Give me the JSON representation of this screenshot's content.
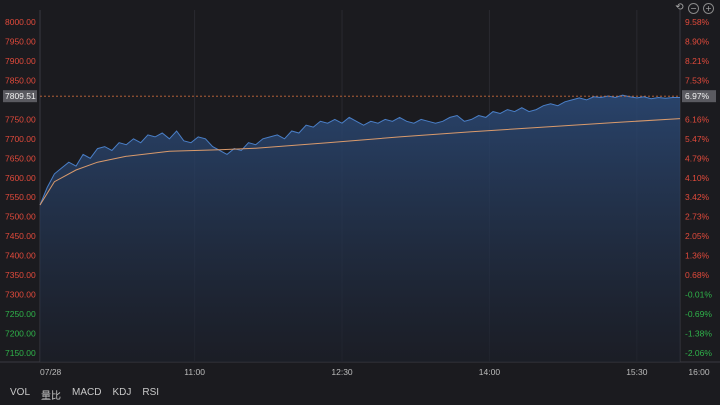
{
  "toolbar": {
    "undo_icon": "undo-icon",
    "zoom_out_icon": "minus-circle-icon",
    "zoom_in_icon": "plus-circle-icon"
  },
  "tabs": [
    "VOL",
    "量比",
    "MACD",
    "KDJ",
    "RSI"
  ],
  "colors": {
    "background": "#1b1b1f",
    "price_line": "#4a7fc7",
    "avg_line": "#d99a6c",
    "up": "#e24a3b",
    "down": "#2fb34a",
    "ref_line": "#c86a3a"
  },
  "chart_data": {
    "type": "area",
    "x_ticks": [
      "07/28",
      "11:00",
      "12:30",
      "14:00",
      "15:30",
      "16:00"
    ],
    "y_ticks": [
      "8000.00",
      "7950.00",
      "7900.00",
      "7850.00",
      "7809.51",
      "7750.00",
      "7700.00",
      "7650.00",
      "7600.00",
      "7550.00",
      "7500.00",
      "7450.00",
      "7400.00",
      "7350.00",
      "7300.00",
      "7250.00",
      "7200.00",
      "7150.00"
    ],
    "y_values": [
      8000,
      7950,
      7900,
      7850,
      7809.51,
      7750,
      7700,
      7650,
      7600,
      7550,
      7500,
      7450,
      7400,
      7350,
      7300,
      7250,
      7200,
      7150
    ],
    "pct_ticks": [
      "9.58%",
      "8.90%",
      "8.21%",
      "7.53%",
      "6.97%",
      "6.16%",
      "5.47%",
      "4.79%",
      "4.10%",
      "3.42%",
      "2.73%",
      "2.05%",
      "1.36%",
      "0.68%",
      "-0.01%",
      "-0.69%",
      "-1.38%",
      "-2.06%"
    ],
    "current_price": "7809.51",
    "current_pct": "6.97%",
    "ylim": [
      7150,
      8000
    ],
    "price_series": [
      [
        0,
        7530
      ],
      [
        2,
        7575
      ],
      [
        4,
        7610
      ],
      [
        6,
        7625
      ],
      [
        8,
        7640
      ],
      [
        10,
        7630
      ],
      [
        12,
        7660
      ],
      [
        14,
        7650
      ],
      [
        16,
        7675
      ],
      [
        18,
        7680
      ],
      [
        20,
        7670
      ],
      [
        22,
        7690
      ],
      [
        24,
        7685
      ],
      [
        26,
        7700
      ],
      [
        28,
        7690
      ],
      [
        30,
        7710
      ],
      [
        32,
        7705
      ],
      [
        34,
        7715
      ],
      [
        36,
        7700
      ],
      [
        38,
        7720
      ],
      [
        40,
        7695
      ],
      [
        42,
        7690
      ],
      [
        44,
        7705
      ],
      [
        46,
        7700
      ],
      [
        48,
        7680
      ],
      [
        50,
        7670
      ],
      [
        52,
        7660
      ],
      [
        54,
        7675
      ],
      [
        56,
        7670
      ],
      [
        58,
        7690
      ],
      [
        60,
        7685
      ],
      [
        62,
        7700
      ],
      [
        64,
        7705
      ],
      [
        66,
        7710
      ],
      [
        68,
        7700
      ],
      [
        70,
        7720
      ],
      [
        72,
        7715
      ],
      [
        74,
        7735
      ],
      [
        76,
        7730
      ],
      [
        78,
        7745
      ],
      [
        80,
        7740
      ],
      [
        82,
        7750
      ],
      [
        84,
        7740
      ],
      [
        86,
        7755
      ],
      [
        88,
        7745
      ],
      [
        90,
        7735
      ],
      [
        92,
        7745
      ],
      [
        94,
        7740
      ],
      [
        96,
        7750
      ],
      [
        98,
        7745
      ],
      [
        100,
        7755
      ],
      [
        102,
        7745
      ],
      [
        104,
        7740
      ],
      [
        106,
        7750
      ],
      [
        108,
        7745
      ],
      [
        110,
        7740
      ],
      [
        112,
        7745
      ],
      [
        114,
        7755
      ],
      [
        116,
        7760
      ],
      [
        118,
        7745
      ],
      [
        120,
        7750
      ],
      [
        122,
        7760
      ],
      [
        124,
        7755
      ],
      [
        126,
        7770
      ],
      [
        128,
        7765
      ],
      [
        130,
        7775
      ],
      [
        132,
        7770
      ],
      [
        134,
        7780
      ],
      [
        136,
        7770
      ],
      [
        138,
        7775
      ],
      [
        140,
        7785
      ],
      [
        142,
        7790
      ],
      [
        144,
        7785
      ],
      [
        146,
        7795
      ],
      [
        148,
        7800
      ],
      [
        150,
        7805
      ],
      [
        152,
        7800
      ],
      [
        154,
        7808
      ],
      [
        156,
        7806
      ],
      [
        158,
        7810
      ],
      [
        160,
        7806
      ],
      [
        162,
        7812
      ],
      [
        164,
        7808
      ],
      [
        166,
        7805
      ],
      [
        168,
        7808
      ],
      [
        170,
        7803
      ],
      [
        172,
        7806
      ],
      [
        174,
        7804
      ],
      [
        176,
        7806
      ],
      [
        178,
        7806
      ]
    ],
    "avg_series": [
      [
        0,
        7530
      ],
      [
        4,
        7590
      ],
      [
        10,
        7620
      ],
      [
        16,
        7640
      ],
      [
        24,
        7655
      ],
      [
        36,
        7668
      ],
      [
        50,
        7672
      ],
      [
        60,
        7676
      ],
      [
        80,
        7690
      ],
      [
        100,
        7705
      ],
      [
        120,
        7718
      ],
      [
        140,
        7730
      ],
      [
        160,
        7742
      ],
      [
        178,
        7752
      ]
    ],
    "x_tick_positions": [
      0,
      43,
      84,
      125,
      166,
      178
    ]
  }
}
